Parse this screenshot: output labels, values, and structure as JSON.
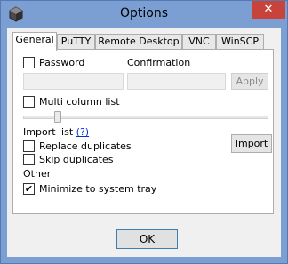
{
  "window": {
    "title": "Options",
    "close_glyph": "✕"
  },
  "tabs": [
    {
      "label": "General",
      "active": true
    },
    {
      "label": "PuTTY",
      "active": false
    },
    {
      "label": "Remote Desktop",
      "active": false
    },
    {
      "label": "VNC",
      "active": false
    },
    {
      "label": "WinSCP",
      "active": false
    }
  ],
  "general": {
    "password_label": "Password",
    "password_checked": false,
    "confirmation_label": "Confirmation",
    "password_value": "",
    "confirmation_value": "",
    "apply_label": "Apply",
    "multicolumn_label": "Multi column list",
    "multicolumn_checked": false,
    "slider_level": 0.13,
    "import_list_label": "Import list",
    "import_help_link": "(?)",
    "replace_duplicates_label": "Replace duplicates",
    "replace_duplicates_checked": false,
    "skip_duplicates_label": "Skip duplicates",
    "skip_duplicates_checked": false,
    "import_button_label": "Import",
    "other_label": "Other",
    "minimize_tray_label": "Minimize to system tray",
    "minimize_tray_checked": true
  },
  "footer": {
    "ok_label": "OK"
  },
  "icons": {
    "app": "gear-cube-icon",
    "close": "close-icon",
    "check": "checkmark-icon"
  },
  "colors": {
    "titlebar": "#7b9ed3",
    "close": "#c8443a",
    "link": "#0033cc"
  }
}
